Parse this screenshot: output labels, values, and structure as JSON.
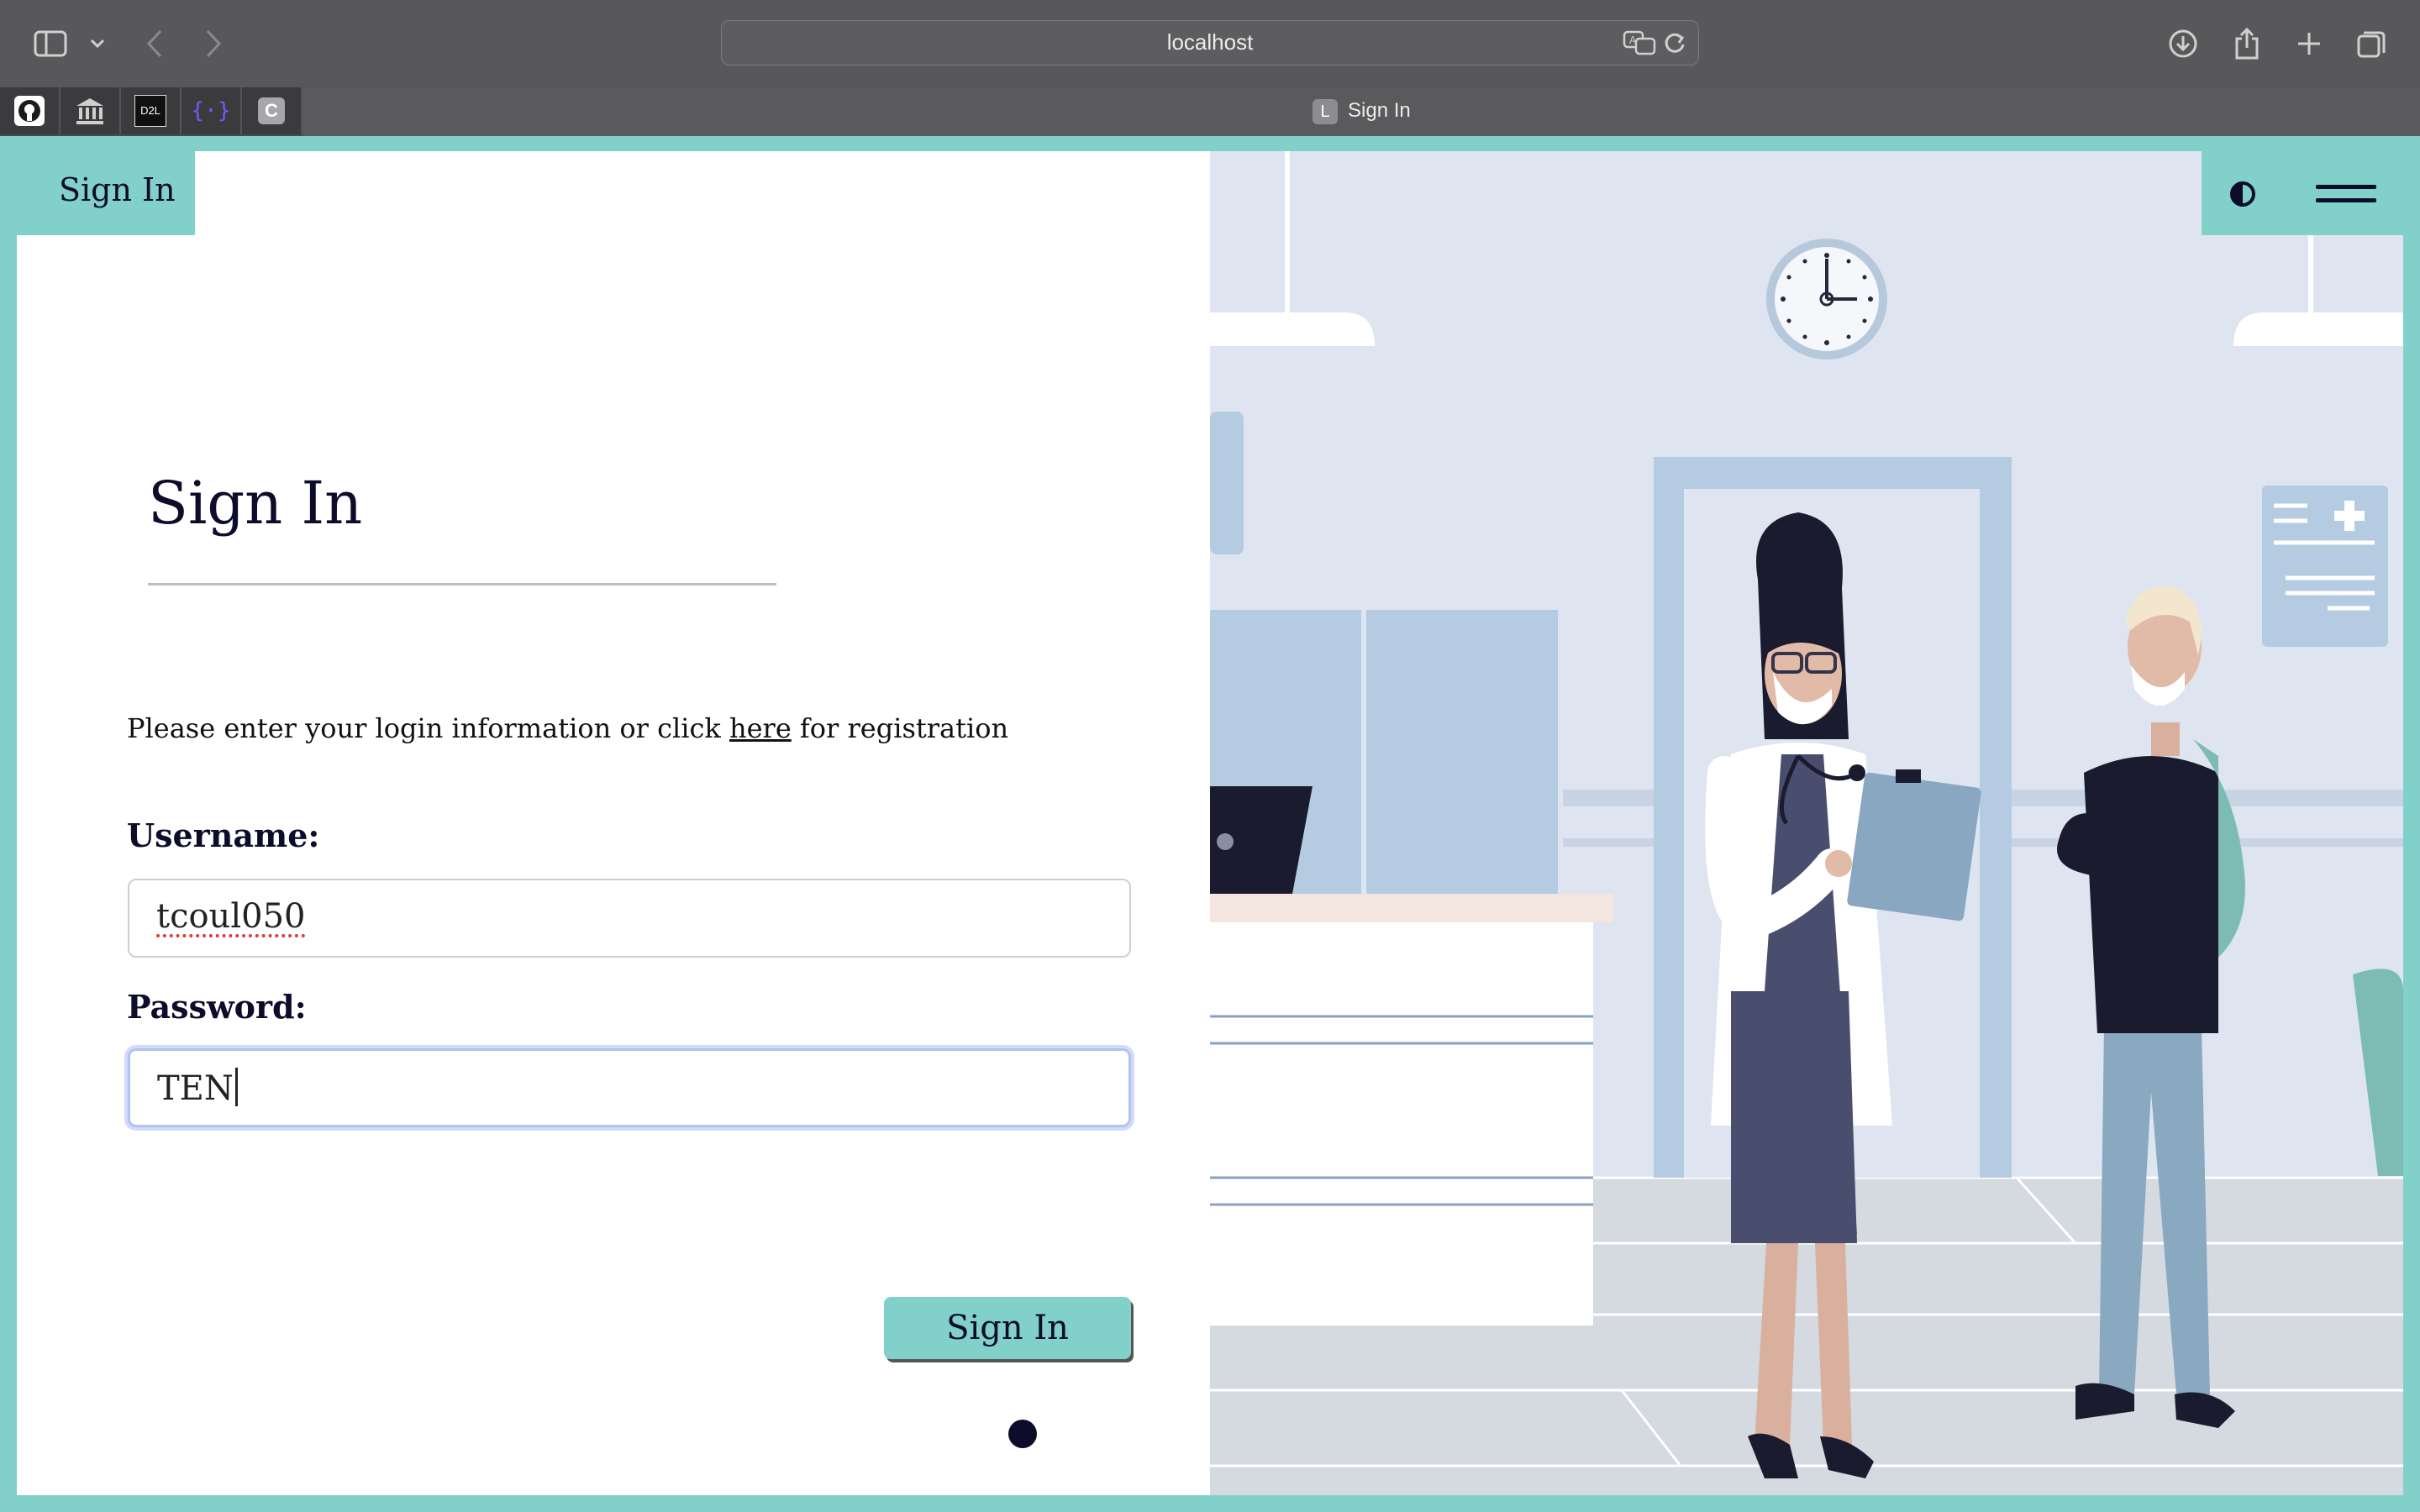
{
  "browser": {
    "address": "localhost",
    "tab_title": "Sign In",
    "tab_favicon": "L",
    "pinned_tabs": [
      "github-icon",
      "bank-icon",
      "D2L",
      "{·}",
      "C"
    ],
    "toolbar_icons": [
      "sidebar-icon",
      "chevron-down-icon",
      "back-icon",
      "forward-icon",
      "translate-icon",
      "reload-icon",
      "download-icon",
      "share-icon",
      "new-tab-icon",
      "tab-overview-icon"
    ]
  },
  "header": {
    "badge": "Sign In",
    "icons": [
      "contrast-icon",
      "hamburger-menu-icon"
    ]
  },
  "form": {
    "heading": "Sign In",
    "info_before": "Please enter your login information or click ",
    "info_link": "here",
    "info_after": " for registration",
    "username_label": "Username:",
    "username_value": "tcoul050",
    "password_label": "Password:",
    "password_value": "TEN",
    "submit_label": "Sign In"
  },
  "colors": {
    "accent": "#82d0ca",
    "text_dark": "#0d0d2b"
  },
  "illustration": "hospital-reception-illustration"
}
